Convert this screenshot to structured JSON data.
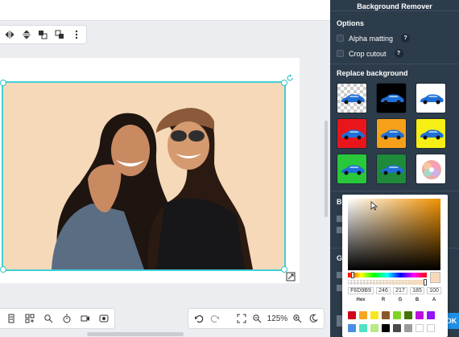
{
  "canvas": {
    "bg_color": "#f6d9b9",
    "selection_color": "#3fd0d6"
  },
  "toolbar_top": {
    "icons": [
      "flip-horizontal-icon",
      "flip-vertical-icon",
      "bring-forward-icon",
      "send-backward-icon",
      "more-vertical-icon"
    ]
  },
  "bottom_left_toolbar": {
    "icons": [
      "layers-icon",
      "grid-icon",
      "search-icon",
      "timer-icon",
      "video-icon",
      "record-icon"
    ]
  },
  "bottom_right_toolbar": {
    "icons": [
      "undo-icon",
      "redo-icon",
      "fit-screen-icon",
      "zoom-out-icon",
      "zoom-in-icon",
      "dark-mode-icon"
    ],
    "zoom": "125%"
  },
  "panel": {
    "title": "Background Remover",
    "options_title": "Options",
    "alpha_matting": "Alpha matting",
    "crop_cutout": "Crop cutout",
    "help_glyph": "?",
    "replace_title": "Replace background",
    "backgrounds": [
      "transparent",
      "#000000",
      "#ffffff",
      "#e8161b",
      "#f6a01a",
      "#f7ee15",
      "#29c83a",
      "#1f8b3a",
      "custom"
    ],
    "side_label_1": "Bl",
    "side_label_2": "Ge",
    "ok_label": "OK"
  },
  "color_picker": {
    "hex": "F6D9B9",
    "r": "246",
    "g": "217",
    "b": "185",
    "a": "100",
    "hex_label": "Hex",
    "r_label": "R",
    "g_label": "G",
    "b_label": "B",
    "a_label": "A",
    "presets": [
      "#d0021b",
      "#f5a623",
      "#f8e71c",
      "#8b572a",
      "#7ed321",
      "#417505",
      "#bd10e0",
      "#9013fe",
      "#4a90e2",
      "#50e3c2",
      "#b8e986",
      "#000000",
      "#4a4a4a",
      "#9b9b9b",
      "#ffffff",
      "#ffffff"
    ]
  }
}
